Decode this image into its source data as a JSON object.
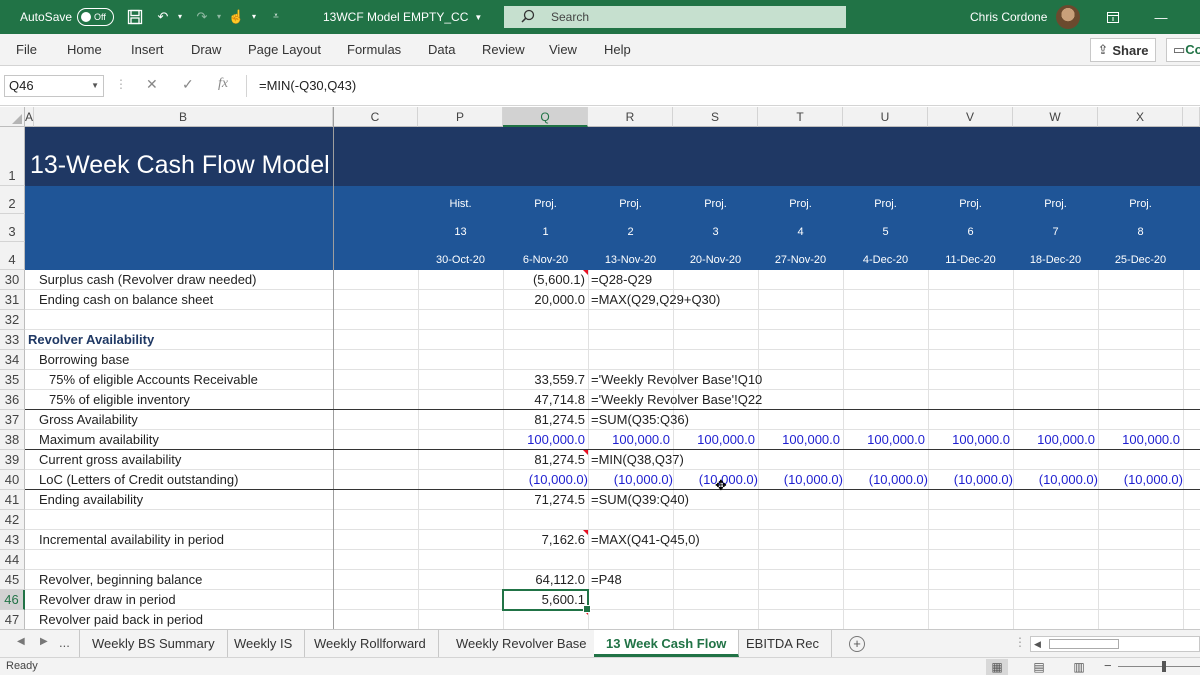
{
  "titlebar": {
    "autosave_label": "AutoSave",
    "autosave_state": "Off",
    "document_title": "13WCF Model EMPTY_CC",
    "search_placeholder": "Search",
    "user_name": "Chris Cordone"
  },
  "menu": {
    "tabs": [
      "File",
      "Home",
      "Insert",
      "Draw",
      "Page Layout",
      "Formulas",
      "Data",
      "Review",
      "View",
      "Help"
    ],
    "share_label": "Share",
    "comments_label": "Co"
  },
  "formula_bar": {
    "name_box": "Q46",
    "formula": "=MIN(-Q30,Q43)"
  },
  "columns": [
    "A",
    "B",
    "C",
    "P",
    "Q",
    "R",
    "S",
    "T",
    "U",
    "V",
    "W",
    "X"
  ],
  "selected_column": "Q",
  "header_rows": {
    "title": "13-Week Cash Flow Model",
    "row2": [
      "Hist.",
      "Proj.",
      "Proj.",
      "Proj.",
      "Proj.",
      "Proj.",
      "Proj.",
      "Proj.",
      "Proj."
    ],
    "row3": [
      "13",
      "1",
      "2",
      "3",
      "4",
      "5",
      "6",
      "7",
      "8"
    ],
    "row4": [
      "30-Oct-20",
      "6-Nov-20",
      "13-Nov-20",
      "20-Nov-20",
      "27-Nov-20",
      "4-Dec-20",
      "11-Dec-20",
      "18-Dec-20",
      "25-Dec-20"
    ]
  },
  "row_numbers": [
    "1",
    "2",
    "3",
    "4",
    "30",
    "31",
    "32",
    "33",
    "34",
    "35",
    "36",
    "37",
    "38",
    "39",
    "40",
    "41",
    "42",
    "43",
    "44",
    "45",
    "46",
    "47"
  ],
  "selected_row": "46",
  "rows": [
    {
      "label": "Surplus cash (Revolver draw needed)",
      "q": "(5,600.1)",
      "formula": "=Q28-Q29"
    },
    {
      "label": "Ending cash on balance sheet",
      "q": "20,000.0",
      "formula": "=MAX(Q29,Q29+Q30)"
    },
    {
      "label": "",
      "q": "",
      "formula": ""
    },
    {
      "label": "Revolver Availability",
      "q": "",
      "formula": ""
    },
    {
      "label": "Borrowing base",
      "q": "",
      "formula": ""
    },
    {
      "label": "75% of eligible Accounts Receivable",
      "q": "33,559.7",
      "formula": "='Weekly Revolver Base'!Q10"
    },
    {
      "label": "75% of eligible inventory",
      "q": "47,714.8",
      "formula": "='Weekly Revolver Base'!Q22"
    },
    {
      "label": "Gross Availability",
      "q": "81,274.5",
      "formula": "=SUM(Q35:Q36)"
    },
    {
      "label": "Maximum availability",
      "q": "100,000.0",
      "formula": ""
    },
    {
      "label": "Current gross availability",
      "q": "81,274.5",
      "formula": "=MIN(Q38,Q37)"
    },
    {
      "label": "LoC (Letters of Credit outstanding)",
      "q": "(10,000.0)",
      "formula": ""
    },
    {
      "label": "Ending availability",
      "q": "71,274.5",
      "formula": "=SUM(Q39:Q40)"
    },
    {
      "label": "",
      "q": "",
      "formula": ""
    },
    {
      "label": "Incremental availability in period",
      "q": "7,162.6",
      "formula": "=MAX(Q41-Q45,0)"
    },
    {
      "label": "",
      "q": "",
      "formula": ""
    },
    {
      "label": "Revolver, beginning balance",
      "q": "64,112.0",
      "formula": "=P48"
    },
    {
      "label": "Revolver draw in period",
      "q": "5,600.1",
      "formula": ""
    },
    {
      "label": "Revolver paid back in period",
      "q": "",
      "formula": ""
    }
  ],
  "row38_values": [
    "100,000.0",
    "100,000.0",
    "100,000.0",
    "100,000.0",
    "100,000.0",
    "100,000.0",
    "100,000.0",
    "100,000.0"
  ],
  "row40_values": [
    "(10,000.0)",
    "(10,000.0)",
    "(10,000.0)",
    "(10,000.0)",
    "(10,000.0)",
    "(10,000.0)",
    "(10,000.0)",
    "(10,000.0)"
  ],
  "sheet_tabs": {
    "ellipsis": "...",
    "tabs": [
      "Weekly BS Summary",
      "Weekly IS",
      "Weekly Rollforward",
      "Weekly Revolver Base",
      "13 Week Cash Flow",
      "EBITDA Rec"
    ],
    "active": "13 Week Cash Flow"
  },
  "status": {
    "text": "Ready"
  },
  "colors": {
    "excel_green": "#217346",
    "title_band": "#1f3864",
    "header_band": "#1f5597",
    "input_blue": "#1f1fd0"
  }
}
